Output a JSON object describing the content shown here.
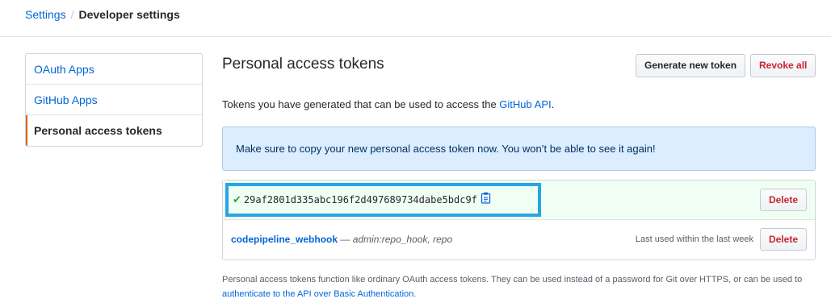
{
  "breadcrumb": {
    "root": "Settings",
    "separator": "/",
    "current": "Developer settings"
  },
  "sidebar": {
    "items": [
      {
        "label": "OAuth Apps",
        "selected": false
      },
      {
        "label": "GitHub Apps",
        "selected": false
      },
      {
        "label": "Personal access tokens",
        "selected": true
      }
    ]
  },
  "main": {
    "title": "Personal access tokens",
    "generate_label": "Generate new token",
    "revoke_label": "Revoke all",
    "intro_text": "Tokens you have generated that can be used to access the ",
    "intro_link": "GitHub API",
    "intro_end": ".",
    "flash": "Make sure to copy your new personal access token now. You won’t be able to see it again!"
  },
  "tokens": {
    "new_token": {
      "value": "29af2801d335abc196f2d497689734dabe5bdc9f",
      "check_icon": "check-icon",
      "copy_icon": "clipboard-icon",
      "delete_label": "Delete"
    },
    "existing": [
      {
        "name": "codepipeline_webhook",
        "dash": " — ",
        "scopes": "admin:repo_hook, repo",
        "last_used": "Last used within the last week",
        "delete_label": "Delete"
      }
    ]
  },
  "note": {
    "text": "Personal access tokens function like ordinary OAuth access tokens. They can be used instead of a password for Git over HTTPS, or can be used to ",
    "link": "authenticate to the API over Basic Authentication",
    "end": "."
  },
  "colors": {
    "link": "#0366d6",
    "danger": "#cb2431",
    "flash_bg": "#dbedff",
    "success_bg": "#f0fff4",
    "highlight_border": "#28a5e6",
    "selected_accent": "#e36209"
  }
}
